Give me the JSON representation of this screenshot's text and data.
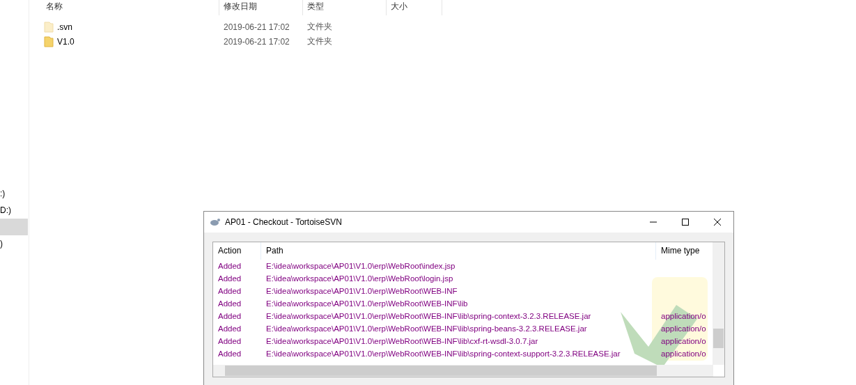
{
  "sidebar": {
    "items": [
      {
        "label": ":)",
        "selected": false
      },
      {
        "label": "D:)",
        "selected": false
      },
      {
        "selected": true
      },
      {
        "label": ")",
        "selected": false
      }
    ]
  },
  "file_list": {
    "columns": [
      "名称",
      "修改日期",
      "类型",
      "大小"
    ],
    "rows": [
      {
        "name": ".svn",
        "modified": "2019-06-21 17:02",
        "type": "文件夹",
        "hidden": true
      },
      {
        "name": "V1.0",
        "modified": "2019-06-21 17:02",
        "type": "文件夹",
        "hidden": false
      }
    ]
  },
  "dialog": {
    "title": "AP01 - Checkout - TortoiseSVN",
    "columns": [
      "Action",
      "Path",
      "Mime type"
    ],
    "rows": [
      {
        "action": "Added",
        "path": "E:\\idea\\workspace\\AP01\\V1.0\\erp\\WebRoot\\index.jsp"
      },
      {
        "action": "Added",
        "path": "E:\\idea\\workspace\\AP01\\V1.0\\erp\\WebRoot\\login.jsp"
      },
      {
        "action": "Added",
        "path": "E:\\idea\\workspace\\AP01\\V1.0\\erp\\WebRoot\\WEB-INF"
      },
      {
        "action": "Added",
        "path": "E:\\idea\\workspace\\AP01\\V1.0\\erp\\WebRoot\\WEB-INF\\lib"
      },
      {
        "action": "Added",
        "path": "E:\\idea\\workspace\\AP01\\V1.0\\erp\\WebRoot\\WEB-INF\\lib\\spring-context-3.2.3.RELEASE.jar",
        "mime": "application/o"
      },
      {
        "action": "Added",
        "path": "E:\\idea\\workspace\\AP01\\V1.0\\erp\\WebRoot\\WEB-INF\\lib\\spring-beans-3.2.3.RELEASE.jar",
        "mime": "application/o"
      },
      {
        "action": "Added",
        "path": "E:\\idea\\workspace\\AP01\\V1.0\\erp\\WebRoot\\WEB-INF\\lib\\cxf-rt-wsdl-3.0.7.jar",
        "mime": "application/o"
      },
      {
        "action": "Added",
        "path": "E:\\idea\\workspace\\AP01\\V1.0\\erp\\WebRoot\\WEB-INF\\lib\\spring-context-support-3.2.3.RELEASE.jar",
        "mime": "application/o"
      }
    ]
  }
}
